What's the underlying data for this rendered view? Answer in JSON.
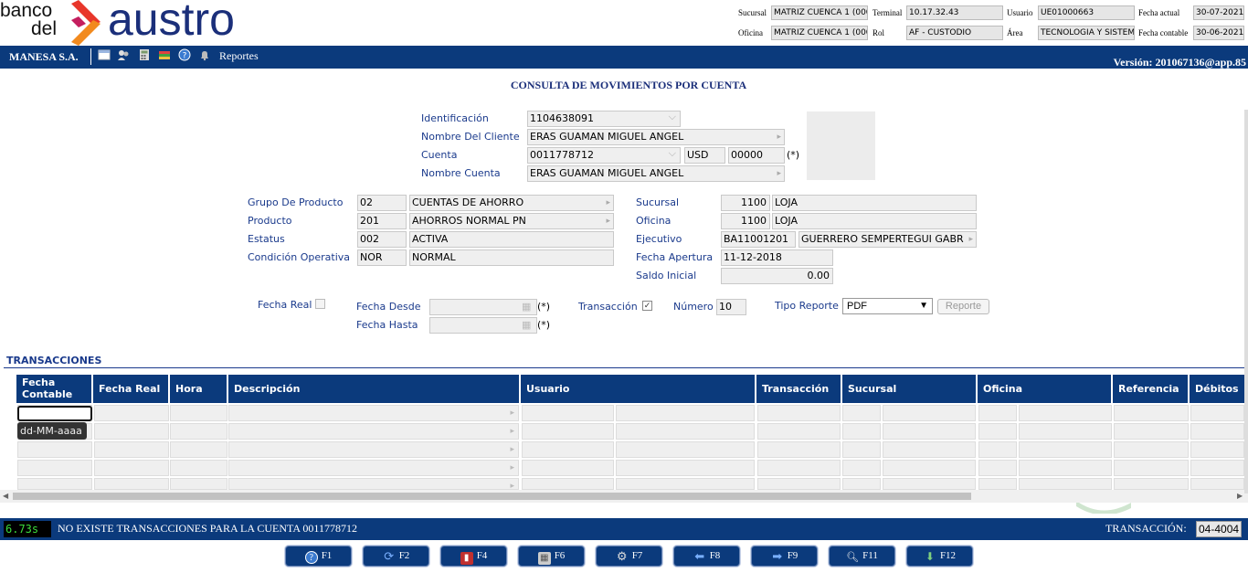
{
  "brand": {
    "line1": "banco",
    "line2": "del",
    "name": "austro"
  },
  "header": {
    "sucursal_label": "Sucursal",
    "sucursal_value": "MATRIZ CUENCA 1 (000",
    "terminal_label": "Terminal",
    "terminal_value": "10.17.32.43",
    "usuario_label": "Usuario",
    "usuario_value": "UE01000663",
    "fecha_actual_label": "Fecha actual",
    "fecha_actual_value": "30-07-2021",
    "oficina_label": "Oficina",
    "oficina_value": "MATRIZ CUENCA 1 (000",
    "rol_label": "Rol",
    "rol_value": "AF - CUSTODIO",
    "area_label": "Área",
    "area_value": "TECNOLOGIA Y SISTEM",
    "fecha_contable_label": "Fecha contable",
    "fecha_contable_value": "30-06-2021"
  },
  "navbar": {
    "company": "MANESA S.A.",
    "reports": "Reportes",
    "version": "Versión: 201067136@app.85",
    "icons": [
      "window-icon",
      "users-icon",
      "calculator-icon",
      "books-icon",
      "help-icon",
      "bell-icon"
    ]
  },
  "page_title": "CONSULTA DE MOVIMIENTOS POR CUENTA",
  "client": {
    "identificacion_label": "Identificación",
    "identificacion": "1104638091",
    "nombre_cliente_label": "Nombre Del Cliente",
    "nombre_cliente": "ERAS GUAMAN MIGUEL ANGEL",
    "cuenta_label": "Cuenta",
    "cuenta": "0011778712",
    "moneda": "USD",
    "sub": "00000",
    "required": "(*)",
    "nombre_cuenta_label": "Nombre Cuenta",
    "nombre_cuenta": "ERAS GUAMAN MIGUEL ANGEL"
  },
  "product": {
    "grupo_label": "Grupo De Producto",
    "grupo_code": "02",
    "grupo_name": "CUENTAS DE AHORRO",
    "producto_label": "Producto",
    "producto_code": "201",
    "producto_name": "AHORROS NORMAL PN",
    "estatus_label": "Estatus",
    "estatus_code": "002",
    "estatus_name": "ACTIVA",
    "condicion_label": "Condición Operativa",
    "condicion_code": "NOR",
    "condicion_name": "NORMAL",
    "sucursal_label": "Sucursal",
    "sucursal_code": "1100",
    "sucursal_name": "LOJA",
    "oficina_label": "Oficina",
    "oficina_code": "1100",
    "oficina_name": "LOJA",
    "ejecutivo_label": "Ejecutivo",
    "ejecutivo_code": "BA11001201",
    "ejecutivo_name": "GUERRERO SEMPERTEGUI GABR",
    "fecha_apertura_label": "Fecha Apertura",
    "fecha_apertura": "11-12-2018",
    "saldo_inicial_label": "Saldo Inicial",
    "saldo_inicial": "0.00"
  },
  "filters": {
    "fecha_real_label": "Fecha Real",
    "fecha_desde_label": "Fecha Desde",
    "fecha_hasta_label": "Fecha Hasta",
    "required": "(*)",
    "transaccion_label": "Transacción",
    "numero_label": "Número",
    "numero": "10",
    "tipo_reporte_label": "Tipo Reporte",
    "tipo_reporte": "PDF",
    "reporte_button": "Reporte"
  },
  "transactions": {
    "title": "TRANSACCIONES",
    "columns": {
      "fecha_contable": "Fecha Contable",
      "fecha_real": "Fecha Real",
      "hora": "Hora",
      "descripcion": "Descripción",
      "usuario": "Usuario",
      "transaccion": "Transacción",
      "sucursal": "Sucursal",
      "oficina": "Oficina",
      "referencia": "Referencia",
      "debitos": "Débitos"
    },
    "date_tooltip": "dd-MM-aaaa"
  },
  "status": {
    "timer": "6.73s",
    "message": "NO EXISTE TRANSACCIONES PARA LA CUENTA 0011778712",
    "transaction_label": "TRANSACCIÓN:",
    "transaction_code": "04-4004"
  },
  "function_keys": [
    "F1",
    "F2",
    "F4",
    "F6",
    "F7",
    "F8",
    "F9",
    "F11",
    "F12"
  ]
}
